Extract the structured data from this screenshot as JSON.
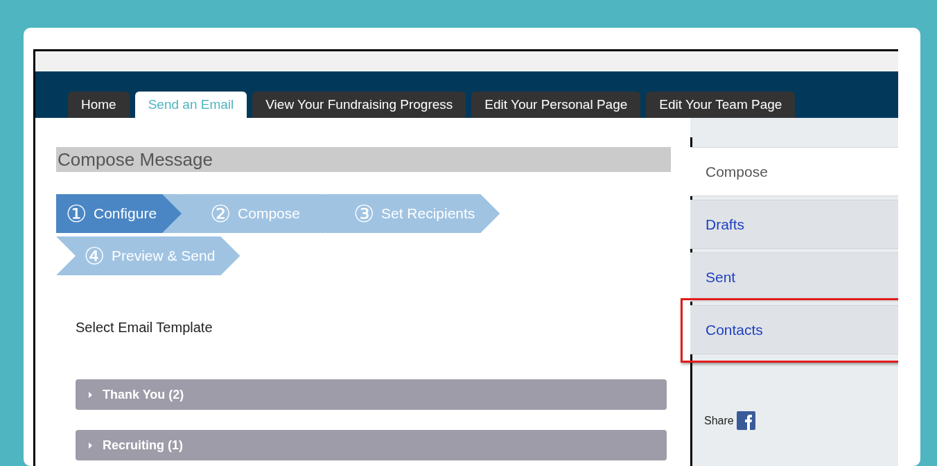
{
  "tabs": [
    {
      "label": "Home",
      "selected": false
    },
    {
      "label": "Send an Email",
      "selected": true
    },
    {
      "label": "View Your Fundraising Progress",
      "selected": false
    },
    {
      "label": "Edit Your Personal Page",
      "selected": false
    },
    {
      "label": "Edit Your Team Page",
      "selected": false
    }
  ],
  "heading": "Compose Message",
  "steps": [
    {
      "number": "①",
      "label": "Configure",
      "selected": true
    },
    {
      "number": "②",
      "label": "Compose",
      "selected": false
    },
    {
      "number": "③",
      "label": "Set Recipients",
      "selected": false
    },
    {
      "number": "④",
      "label": "Preview & Send",
      "selected": false
    }
  ],
  "template_label": "Select Email Template",
  "templates": [
    {
      "label": "Thank You (2)",
      "expanded": false
    },
    {
      "label": "Recruiting (1)",
      "expanded": false
    }
  ],
  "sidebar": {
    "items": [
      {
        "label": "Compose",
        "selected": true,
        "highlighted": false
      },
      {
        "label": "Drafts",
        "selected": false,
        "highlighted": false
      },
      {
        "label": "Sent",
        "selected": false,
        "highlighted": false
      },
      {
        "label": "Contacts",
        "selected": false,
        "highlighted": true
      }
    ],
    "share_label": "Share"
  }
}
